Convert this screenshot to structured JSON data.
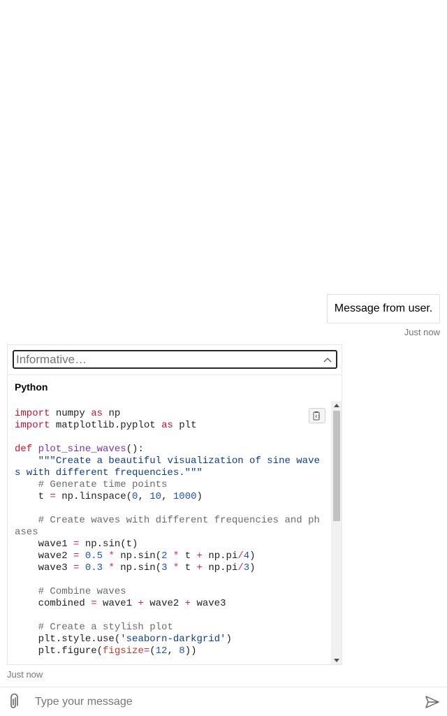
{
  "transcript": {
    "user_message": {
      "text": "Message from user.",
      "timestamp": "Just now"
    },
    "bot_message": {
      "timestamp": "Just now",
      "dropdown": {
        "selected": "Informative…",
        "icon": "chevron-up-icon"
      },
      "code_block": {
        "language": "Python",
        "copy_icon": "copy-code-icon",
        "lines": [
          "import numpy as np",
          "import matplotlib.pyplot as plt",
          "",
          "def plot_sine_waves():",
          "    \"\"\"Create a beautiful visualization of sine waves with different frequencies.\"\"\"",
          "    # Generate time points",
          "    t = np.linspace(0, 10, 1000)",
          "",
          "    # Create waves with different frequencies and phases",
          "    wave1 = np.sin(t)",
          "    wave2 = 0.5 * np.sin(2 * t + np.pi/4)",
          "    wave3 = 0.3 * np.sin(3 * t + np.pi/3)",
          "",
          "    # Combine waves",
          "    combined = wave1 + wave2 + wave3",
          "",
          "    # Create a stylish plot",
          "    plt.style.use('seaborn-darkgrid')",
          "    plt.figure(figsize=(12, 8))"
        ]
      }
    }
  },
  "composer": {
    "placeholder": "Type your message",
    "attach_icon": "paperclip-icon",
    "send_icon": "send-icon"
  }
}
